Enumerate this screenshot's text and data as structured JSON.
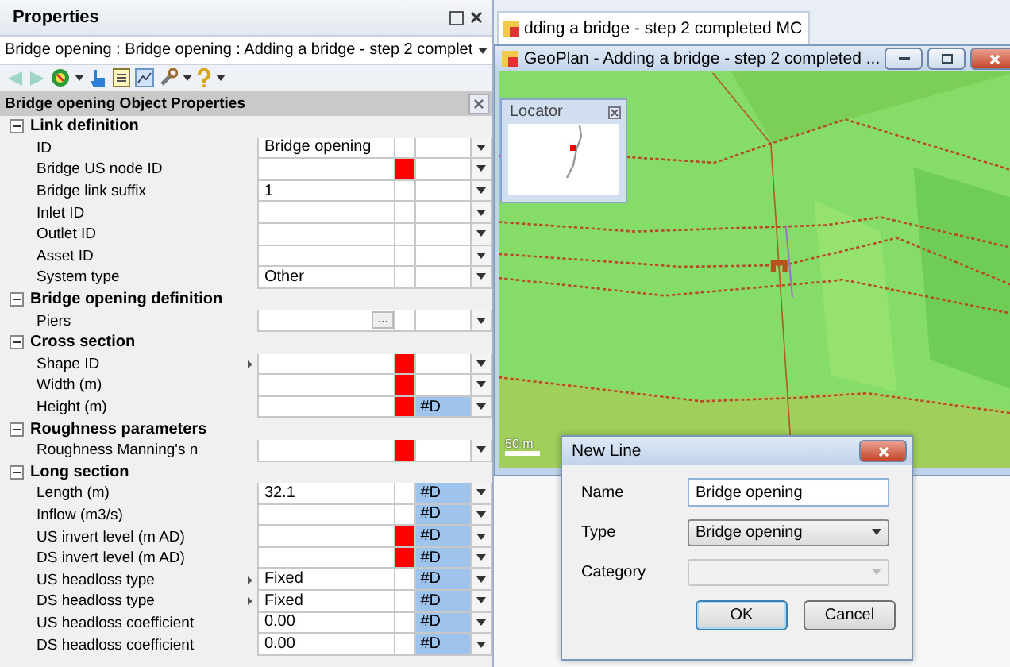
{
  "properties_panel": {
    "title": "Properties",
    "object_selector": "Bridge opening : Bridge opening : Adding a bridge - step 2 complet",
    "grid_title": "Bridge opening Object Properties",
    "sections": [
      {
        "title": "Link definition",
        "expanded": true,
        "rows": [
          {
            "label": "ID",
            "value": "Bridge opening",
            "flagged": false,
            "pointer": false
          },
          {
            "label": "Bridge US node ID",
            "value": "",
            "flagged": true,
            "pointer": false
          },
          {
            "label": "Bridge link suffix",
            "value": "1",
            "flagged": false,
            "pointer": false
          },
          {
            "label": "Inlet ID",
            "value": "",
            "flagged": false,
            "pointer": false
          },
          {
            "label": "Outlet ID",
            "value": "",
            "flagged": false,
            "pointer": false
          },
          {
            "label": "Asset ID",
            "value": "",
            "flagged": false,
            "pointer": false
          },
          {
            "label": "System type",
            "value": "Other",
            "flagged": false,
            "pointer": false
          }
        ]
      },
      {
        "title": "Bridge opening definition",
        "expanded": true,
        "rows": [
          {
            "label": "Piers",
            "value": "",
            "button_text": "...",
            "flagged": false,
            "pointer": false
          }
        ]
      },
      {
        "title": "Cross section",
        "expanded": true,
        "rows": [
          {
            "label": "Shape ID",
            "value": "",
            "flagged": true,
            "pointer": true
          },
          {
            "label": "Width (m)",
            "value": "",
            "flagged": true,
            "pointer": false
          },
          {
            "label": "Height (m)",
            "value": "",
            "flagged": true,
            "pointer": false,
            "unit": "#D"
          }
        ]
      },
      {
        "title": "Roughness parameters",
        "expanded": true,
        "rows": [
          {
            "label": "Roughness Manning's n",
            "value": "",
            "flagged": true,
            "pointer": false
          }
        ]
      },
      {
        "title": "Long section",
        "expanded": true,
        "rows": [
          {
            "label": "Length (m)",
            "value": "32.1",
            "flagged": false,
            "pointer": false,
            "unit": "#D"
          },
          {
            "label": "Inflow (m3/s)",
            "value": "",
            "flagged": false,
            "pointer": false,
            "unit": "#D"
          },
          {
            "label": "US invert level (m AD)",
            "value": "",
            "flagged": true,
            "pointer": false,
            "unit": "#D"
          },
          {
            "label": "DS invert level (m AD)",
            "value": "",
            "flagged": true,
            "pointer": false,
            "unit": "#D"
          },
          {
            "label": "US headloss type",
            "value": "Fixed",
            "flagged": false,
            "pointer": true,
            "unit": "#D"
          },
          {
            "label": "DS headloss type",
            "value": "Fixed",
            "flagged": false,
            "pointer": true,
            "unit": "#D"
          },
          {
            "label": "US headloss coefficient",
            "value": "0.00",
            "flagged": false,
            "pointer": false,
            "unit": "#D"
          },
          {
            "label": "DS headloss coefficient",
            "value": "0.00",
            "flagged": false,
            "pointer": false,
            "unit": "#D"
          }
        ]
      }
    ]
  },
  "document_tab": {
    "title": "dding a bridge - step 2 completed MC"
  },
  "geoplan": {
    "title": "GeoPlan - Adding a bridge - step 2 completed ...",
    "locator": {
      "title": "Locator"
    },
    "scale": "50 m"
  },
  "dialog": {
    "title": "New Line",
    "fields": [
      {
        "kind": "text",
        "label": "Name",
        "value": "Bridge opening",
        "disabled": false
      },
      {
        "kind": "select",
        "label": "Type",
        "value": "Bridge opening",
        "disabled": false
      },
      {
        "kind": "select",
        "label": "Category",
        "disabled": true
      }
    ],
    "buttons": [
      {
        "label": "OK",
        "default": true
      },
      {
        "label": "Cancel",
        "default": false
      }
    ]
  }
}
